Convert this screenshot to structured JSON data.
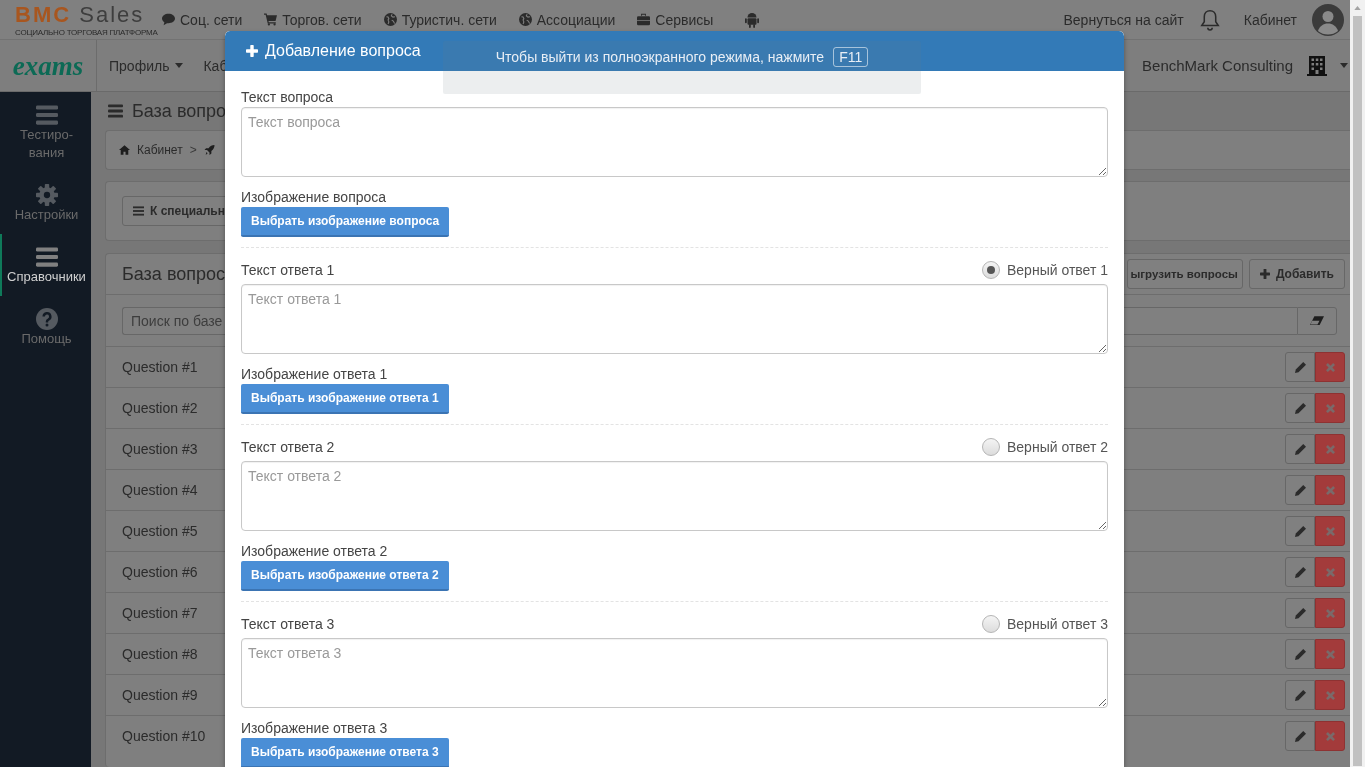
{
  "topbar": {
    "logo": {
      "brand": "BMC",
      "name": "Sales",
      "tagline": "СОЦИАЛЬНО ТОРГОВАЯ ПЛАТФОРМА"
    },
    "nav": [
      "Соц. сети",
      "Торгов. сети",
      "Туристич. сети",
      "Ассоциации",
      "Сервисы"
    ],
    "return_link": "Вернуться на сайт",
    "account_link": "Кабинет"
  },
  "subbar": {
    "logo": "exams",
    "menu": [
      {
        "label": "Профиль",
        "dropdown": true
      },
      {
        "label": "Каб",
        "dropdown": false
      }
    ],
    "company": "BenchMark Consulting"
  },
  "sidebar": {
    "items": [
      {
        "label": "Тестиро-вания",
        "selected": false
      },
      {
        "label": "Настройки",
        "selected": false
      },
      {
        "label": "Справочники",
        "selected": true
      },
      {
        "label": "Помощь",
        "selected": false
      }
    ]
  },
  "main": {
    "title": "База вопро",
    "breadcrumb": {
      "items": [
        "Кабинет"
      ],
      "separator": ">"
    },
    "back_button": "К специальн",
    "questions_panel": {
      "title": "База вопрос",
      "buttons": [
        "ыгрузить вопросы",
        "Добавить"
      ],
      "search_placeholder": "Поиск по базе",
      "rows": [
        "Question #1",
        "Question #2",
        "Question #3",
        "Question #4",
        "Question #5",
        "Question #6",
        "Question #7",
        "Question #8",
        "Question #9",
        "Question #10"
      ]
    }
  },
  "modal": {
    "title": "Добавление вопроса",
    "question": {
      "label": "Текст вопроса",
      "placeholder": "Текст вопроса",
      "image_label": "Изображение вопроса",
      "image_button": "Выбрать изображение вопроса"
    },
    "answers": [
      {
        "label": "Текст ответа 1",
        "correct_label": "Верный ответ 1",
        "selected": true,
        "placeholder": "Текст ответа 1",
        "image_label": "Изображение ответа 1",
        "image_button": "Выбрать изображение ответа 1"
      },
      {
        "label": "Текст ответа 2",
        "correct_label": "Верный ответ 2",
        "selected": false,
        "placeholder": "Текст ответа 2",
        "image_label": "Изображение ответа 2",
        "image_button": "Выбрать изображение ответа 2"
      },
      {
        "label": "Текст ответа 3",
        "correct_label": "Верный ответ 3",
        "selected": false,
        "placeholder": "Текст ответа 3",
        "image_label": "Изображение ответа 3",
        "image_button": "Выбрать изображение ответа 3"
      }
    ]
  },
  "fullscreen_notice": {
    "text": "Чтобы выйти из полноэкранного режима, нажмите",
    "key": "F11"
  }
}
